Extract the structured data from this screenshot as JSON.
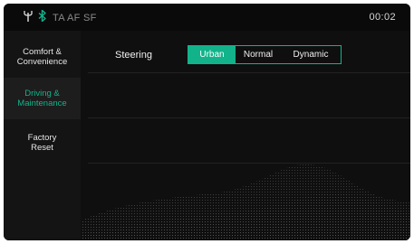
{
  "status_bar": {
    "icons": [
      "antenna-icon",
      "bluetooth-icon"
    ],
    "indicators": "TA AF SF",
    "clock": "00:02"
  },
  "sidebar": {
    "items": [
      {
        "label_line1": "Comfort &",
        "label_line2": "Convenience",
        "active": false
      },
      {
        "label_line1": "Driving &",
        "label_line2": "Maintenance",
        "active": true
      },
      {
        "label_line1": "Factory",
        "label_line2": "Reset",
        "active": false
      }
    ]
  },
  "main": {
    "steering": {
      "label": "Steering",
      "options": [
        "Urban",
        "Normal",
        "Dynamic"
      ],
      "selected": "Urban"
    }
  },
  "colors": {
    "accent": "#12b38a",
    "background": "#0f0f0f",
    "sidebar": "#141414",
    "text": "#f0f0f0"
  }
}
